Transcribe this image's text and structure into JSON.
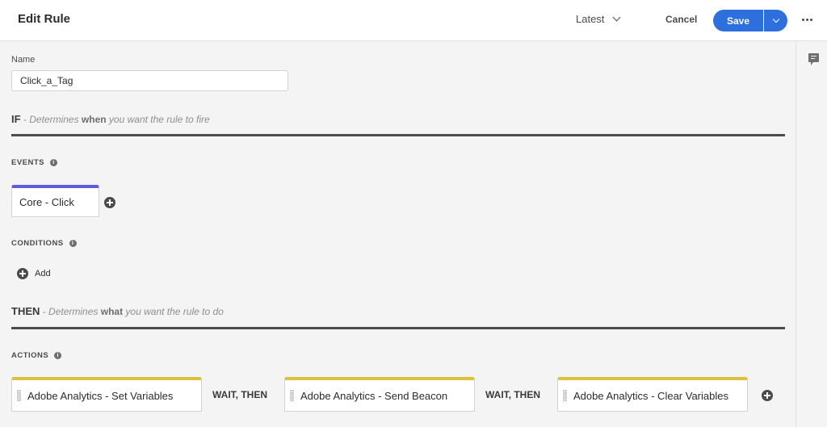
{
  "header": {
    "title": "Edit Rule",
    "version_label": "Latest",
    "cancel_label": "Cancel",
    "save_label": "Save"
  },
  "name_field": {
    "label": "Name",
    "value": "Click_a_Tag"
  },
  "if_section": {
    "keyword": "IF",
    "desc_prefix": " - Determines ",
    "desc_emphasis": "when",
    "desc_suffix": " you want the rule to fire"
  },
  "events": {
    "heading": "EVENTS",
    "info_glyph": "i",
    "items": [
      {
        "label": "Core - Click",
        "accent": "#5c5ce0"
      }
    ]
  },
  "conditions": {
    "heading": "CONDITIONS",
    "info_glyph": "i",
    "add_label": "Add"
  },
  "then_section": {
    "keyword": "THEN",
    "desc_prefix": " - Determines ",
    "desc_emphasis": "what",
    "desc_suffix": " you want the rule to do"
  },
  "actions": {
    "heading": "ACTIONS",
    "info_glyph": "i",
    "accent": "#dcc23c",
    "separator": "WAIT, THEN",
    "items": [
      {
        "label": "Adobe Analytics - Set Variables"
      },
      {
        "label": "Adobe Analytics - Send Beacon"
      },
      {
        "label": "Adobe Analytics - Clear Variables"
      }
    ]
  },
  "colors": {
    "primary_button": "#2d6fdc",
    "event_accent": "#5c5ce0",
    "action_accent": "#dcc23c"
  },
  "icons": [
    "chevron-down-icon",
    "more-icon",
    "comment-icon",
    "info-icon",
    "plus-icon",
    "drag-handle-icon"
  ]
}
